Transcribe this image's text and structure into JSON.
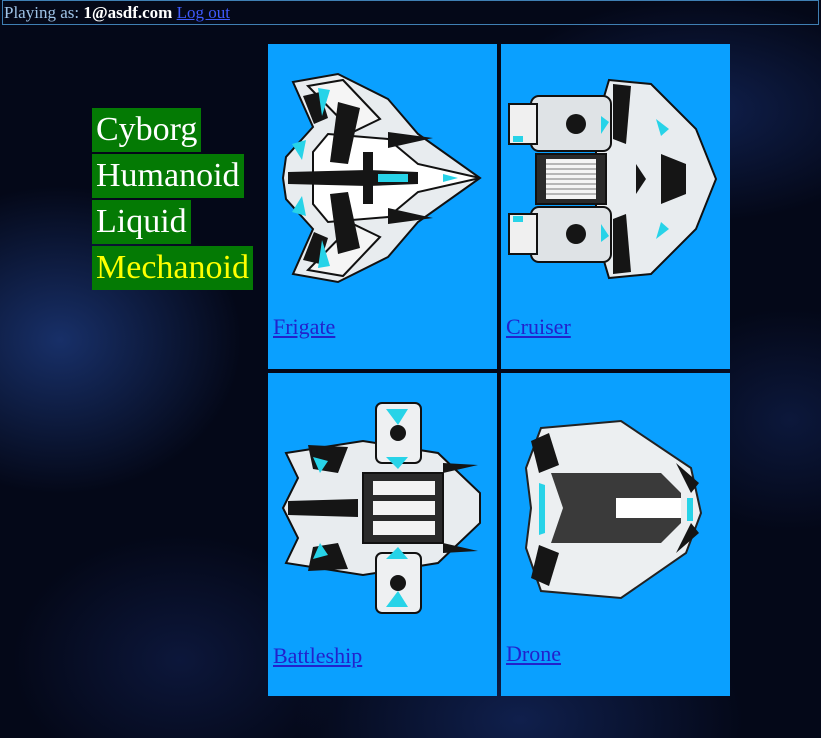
{
  "header": {
    "playing_as_label": "Playing as:",
    "user_email": "1@asdf.com",
    "logout_label": "Log out"
  },
  "races": [
    {
      "label": "Cyborg",
      "selected": false
    },
    {
      "label": "Humanoid",
      "selected": false
    },
    {
      "label": "Liquid",
      "selected": false
    },
    {
      "label": "Mechanoid",
      "selected": true
    }
  ],
  "ships": [
    {
      "label": "Frigate",
      "icon": "frigate-ship-icon"
    },
    {
      "label": "Cruiser",
      "icon": "cruiser-ship-icon"
    },
    {
      "label": "Battleship",
      "icon": "battleship-ship-icon"
    },
    {
      "label": "Drone",
      "icon": "drone-ship-icon"
    }
  ],
  "colors": {
    "card_background": "#0aa0ff",
    "race_background": "#047a04",
    "race_selected_text": "#ffff00",
    "race_text": "#ffffff",
    "link": "#2222cc",
    "ship_accent": "#27d3e8"
  }
}
